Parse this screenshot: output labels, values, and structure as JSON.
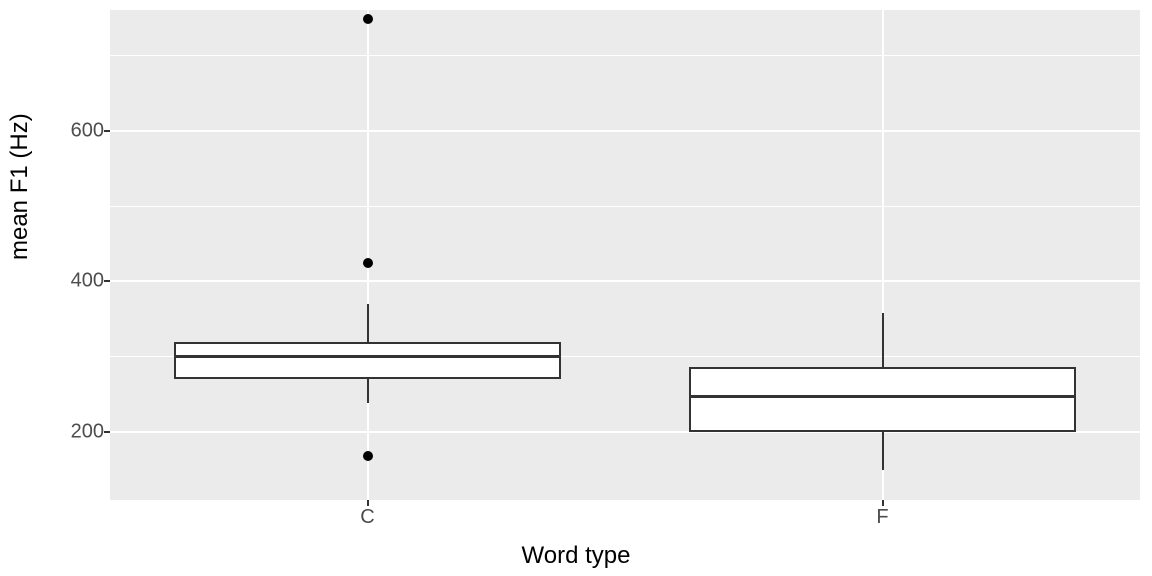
{
  "chart_data": {
    "type": "boxplot",
    "xlabel": "Word type",
    "ylabel": "mean F1 (Hz)",
    "categories": [
      "C",
      "F"
    ],
    "ylim": [
      110,
      760
    ],
    "y_ticks": [
      200,
      400,
      600
    ],
    "y_minor_ticks": [
      300,
      500,
      700
    ],
    "series": [
      {
        "name": "C",
        "q1": 270,
        "median": 300,
        "q3": 320,
        "whisker_low": 238,
        "whisker_high": 370,
        "outliers": [
          168,
          425,
          748
        ]
      },
      {
        "name": "F",
        "q1": 200,
        "median": 247,
        "q3": 287,
        "whisker_low": 150,
        "whisker_high": 358,
        "outliers": []
      }
    ]
  },
  "style": {
    "panel_bg": "#ebebeb",
    "grid_color": "#ffffff",
    "box_fill": "#ffffff",
    "box_stroke": "#333333",
    "outlier_fill": "#000000",
    "box_width_frac": 0.75
  }
}
